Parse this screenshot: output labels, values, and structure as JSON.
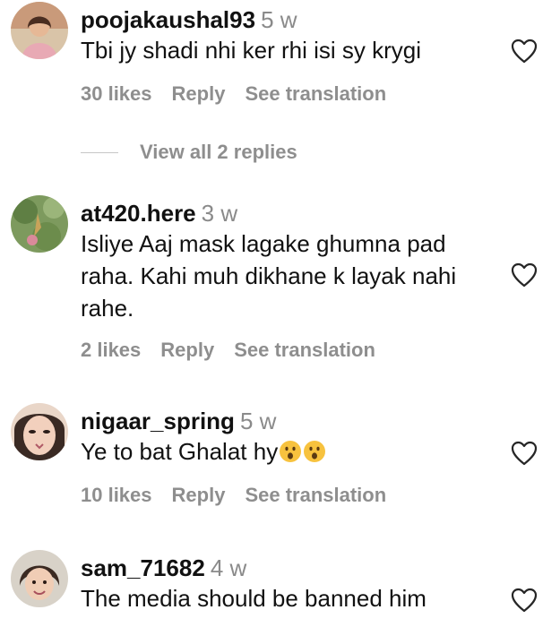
{
  "comments": [
    {
      "username": "poojakaushal93",
      "time": "5 w",
      "text": "Tbi jy shadi nhi ker rhi isi sy krygi",
      "likes": "30 likes",
      "reply": "Reply",
      "see_translation": "See translation"
    },
    {
      "username": "at420.here",
      "time": "3 w",
      "text": "Isliye Aaj mask lagake ghumna pad raha. Kahi muh dikhane k layak nahi rahe.",
      "likes": "2 likes",
      "reply": "Reply",
      "see_translation": "See translation"
    },
    {
      "username": "nigaar_spring",
      "time": "5 w",
      "text": "Ye to bat Ghalat hy",
      "emoji": "hushed-face-emoji",
      "likes": "10 likes",
      "reply": "Reply",
      "see_translation": "See translation"
    },
    {
      "username": "sam_71682",
      "time": "4 w",
      "text": "The media should be banned him"
    }
  ],
  "view_replies": "View all 2 replies",
  "icons": {
    "like": "heart-outline-icon"
  },
  "colors": {
    "muted_text": "#8e8e8e",
    "primary_text": "#111111"
  }
}
